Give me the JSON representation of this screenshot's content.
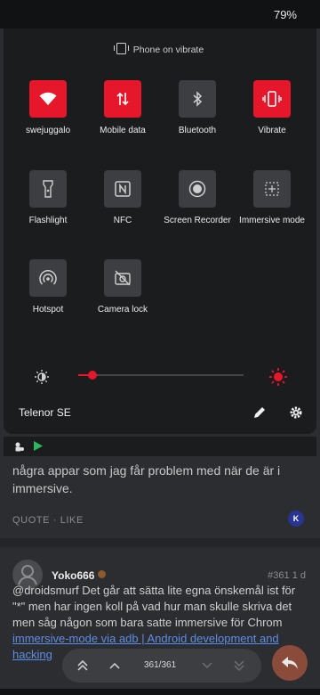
{
  "status_bar": {
    "battery": "79%"
  },
  "quick_settings": {
    "vibrate_note": "Phone on vibrate",
    "tiles": [
      {
        "label": "swejuggalo",
        "icon": "wifi-icon",
        "active": true
      },
      {
        "label": "Mobile data",
        "icon": "mobile-data-icon",
        "active": true
      },
      {
        "label": "Bluetooth",
        "icon": "bluetooth-icon",
        "active": false
      },
      {
        "label": "Vibrate",
        "icon": "vibrate-icon",
        "active": true
      },
      {
        "label": "Flashlight",
        "icon": "flashlight-icon",
        "active": false
      },
      {
        "label": "NFC",
        "icon": "nfc-icon",
        "active": false
      },
      {
        "label": "Screen Recorder",
        "icon": "screen-recorder-icon",
        "active": false
      },
      {
        "label": "Immersive mode",
        "icon": "immersive-mode-icon",
        "active": false
      },
      {
        "label": "Hotspot",
        "icon": "hotspot-icon",
        "active": false
      },
      {
        "label": "Camera lock",
        "icon": "camera-lock-icon",
        "active": false
      }
    ],
    "brightness": {
      "level": 0.08
    },
    "carrier": "Telenor SE"
  },
  "accent_color": "#e6172b",
  "post_prev": {
    "text": "några appar som jag får problem med när de är i immersive.",
    "actions": "QUOTE · LIKE",
    "badge": "K"
  },
  "post": {
    "username": "Yoko666",
    "post_no": "#361",
    "age": "1 d",
    "text_plain": "@droidsmurf Det går att sätta lite egna önskemål ist för \"*\" men har ingen koll på vad hur man skulle skriva det men såg någon som bara satte immersive för Chrom",
    "text_link": "immersive-mode via adb | Android development and hacking"
  },
  "pagination": {
    "label": "361/361"
  }
}
